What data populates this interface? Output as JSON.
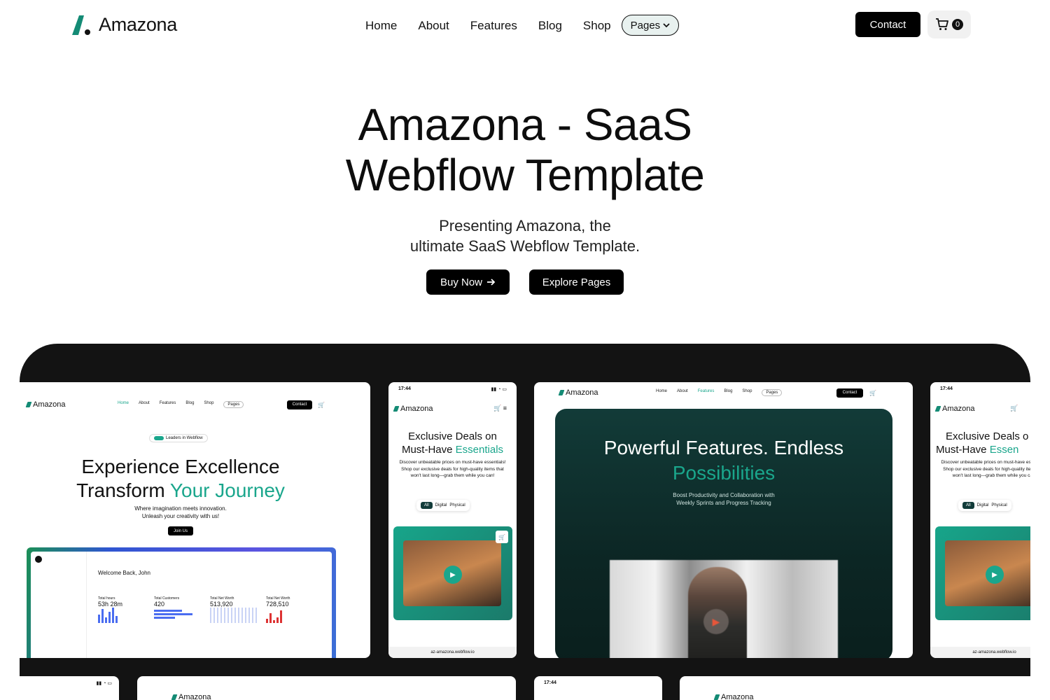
{
  "nav": {
    "logo_text": "Amazona",
    "links": [
      "Home",
      "About",
      "Features",
      "Blog",
      "Shop"
    ],
    "pages_label": "Pages",
    "contact_label": "Contact",
    "cart_count": "0"
  },
  "hero": {
    "title_line1": "Amazona - SaaS",
    "title_line2": "Webflow Template",
    "subtitle_line1": "Presenting Amazona, the",
    "subtitle_line2": "ultimate SaaS Webflow Template.",
    "buy_label": "Buy Now",
    "explore_label": "Explore Pages"
  },
  "showcase": {
    "desktop1": {
      "logo": "Amazona",
      "links": [
        "Home",
        "About",
        "Features",
        "Blog",
        "Shop"
      ],
      "pages": "Pages",
      "contact": "Contact",
      "badge": "Leaders in Webflow",
      "heading1": "Experience Excellence",
      "heading2a": "Transform ",
      "heading2b": "Your Journey",
      "sub1": "Where imagination meets innovation.",
      "sub2": "Unleash your creativity with us!",
      "cta": "Join Us",
      "dash_welcome": "Welcome Back, John",
      "stats": [
        {
          "label": "Total hours",
          "value": "53h 28m"
        },
        {
          "label": "Total Customers",
          "value": "420"
        },
        {
          "label": "Total Net Worth",
          "value": "513,920"
        },
        {
          "label": "Total Net Worth",
          "value": "728,510"
        }
      ]
    },
    "mobile1": {
      "time": "17:44",
      "logo": "Amazona",
      "heading1": "Exclusive Deals on",
      "heading2a": "Must-Have ",
      "heading2b": "Essentials",
      "body": "Discover unbeatable prices on must-have essentials! Shop our exclusive deals for high-quality items that won't last long—grab them while you can!",
      "tabs": [
        "All",
        "Digital",
        "Physical"
      ],
      "url": "az-amazona.webflow.io"
    },
    "desktop2": {
      "logo": "Amazona",
      "links": [
        "Home",
        "About",
        "Features",
        "Blog",
        "Shop"
      ],
      "pages": "Pages",
      "contact": "Contact",
      "heading1": "Powerful Features. Endless",
      "heading2": "Possibilities",
      "sub1": "Boost Productivity and Collaboration with",
      "sub2": "Weekly Sprints and Progress Tracking"
    },
    "mobile2": {
      "time": "17:44",
      "logo": "Amazona",
      "heading1": "Exclusive Deals o",
      "heading2a": "Must-Have ",
      "heading2b": "Essen",
      "body": "Discover unbeatable prices on must-have essentials! Shop our exclusive deals for high-quality items that won't last long—grab them while you can!",
      "tabs": [
        "All",
        "Digital",
        "Physical"
      ],
      "url": "az-amazona.webflow.io"
    },
    "row2": {
      "time": "17:44",
      "logo": "Amazona"
    }
  },
  "colors": {
    "accent": "#1aa68c",
    "dark_teal": "#123b38",
    "showcase_bg": "#131313"
  }
}
